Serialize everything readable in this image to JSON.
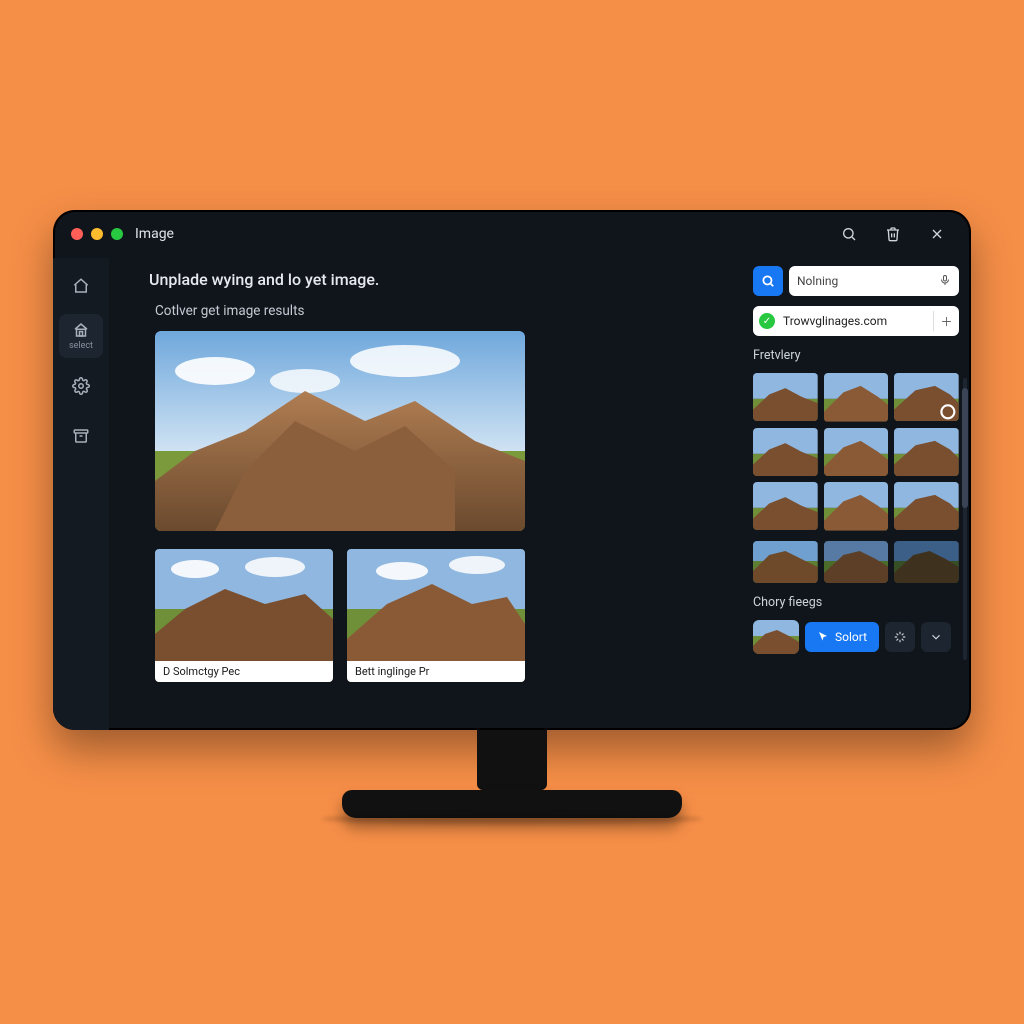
{
  "titlebar": {
    "title": "Image"
  },
  "sidebar": {
    "items": [
      {
        "name": "home"
      },
      {
        "name": "select",
        "label": "select"
      },
      {
        "name": "settings"
      },
      {
        "name": "archive"
      }
    ]
  },
  "main": {
    "headline": "Unplade wying and lo yet image.",
    "subhead": "Cotlver get image results",
    "cards": [
      {
        "caption": "D Solmctgy Pec"
      },
      {
        "caption": "Bett inglinge Pr"
      }
    ]
  },
  "rpanel": {
    "search_value": "Nolning",
    "url_text": "Trowvglinages.com",
    "section1_label": "Fretvlery",
    "section2_label": "Chory fieegs",
    "select_label": "Solort"
  }
}
